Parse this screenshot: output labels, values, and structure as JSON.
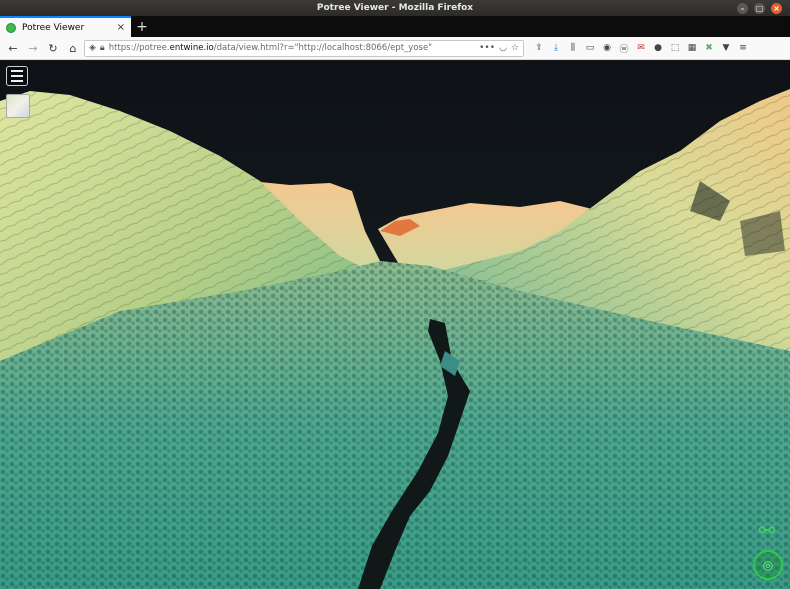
{
  "window": {
    "title": "Potree Viewer - Mozilla Firefox"
  },
  "tabs": [
    {
      "label": "Potree Viewer"
    }
  ],
  "navbar": {
    "url_prefix": "https://potree.",
    "url_host": "entwine.io",
    "url_path": "/data/view.html?r=\"http://localhost:8066/ept_yose\""
  },
  "icons": {
    "back": "arrow-left-icon",
    "forward": "arrow-right-icon",
    "reload": "reload-icon",
    "home": "home-icon",
    "shield": "shield-icon",
    "lock": "lock-icon",
    "menu": "hamburger-icon"
  },
  "colors": {
    "sky": "#0f1418",
    "terrain_high": "#e8b87a",
    "terrain_mid": "#c8d890",
    "terrain_low": "#3fa890",
    "accent_green": "#2fc84d",
    "tab_accent": "#0a84ff"
  }
}
